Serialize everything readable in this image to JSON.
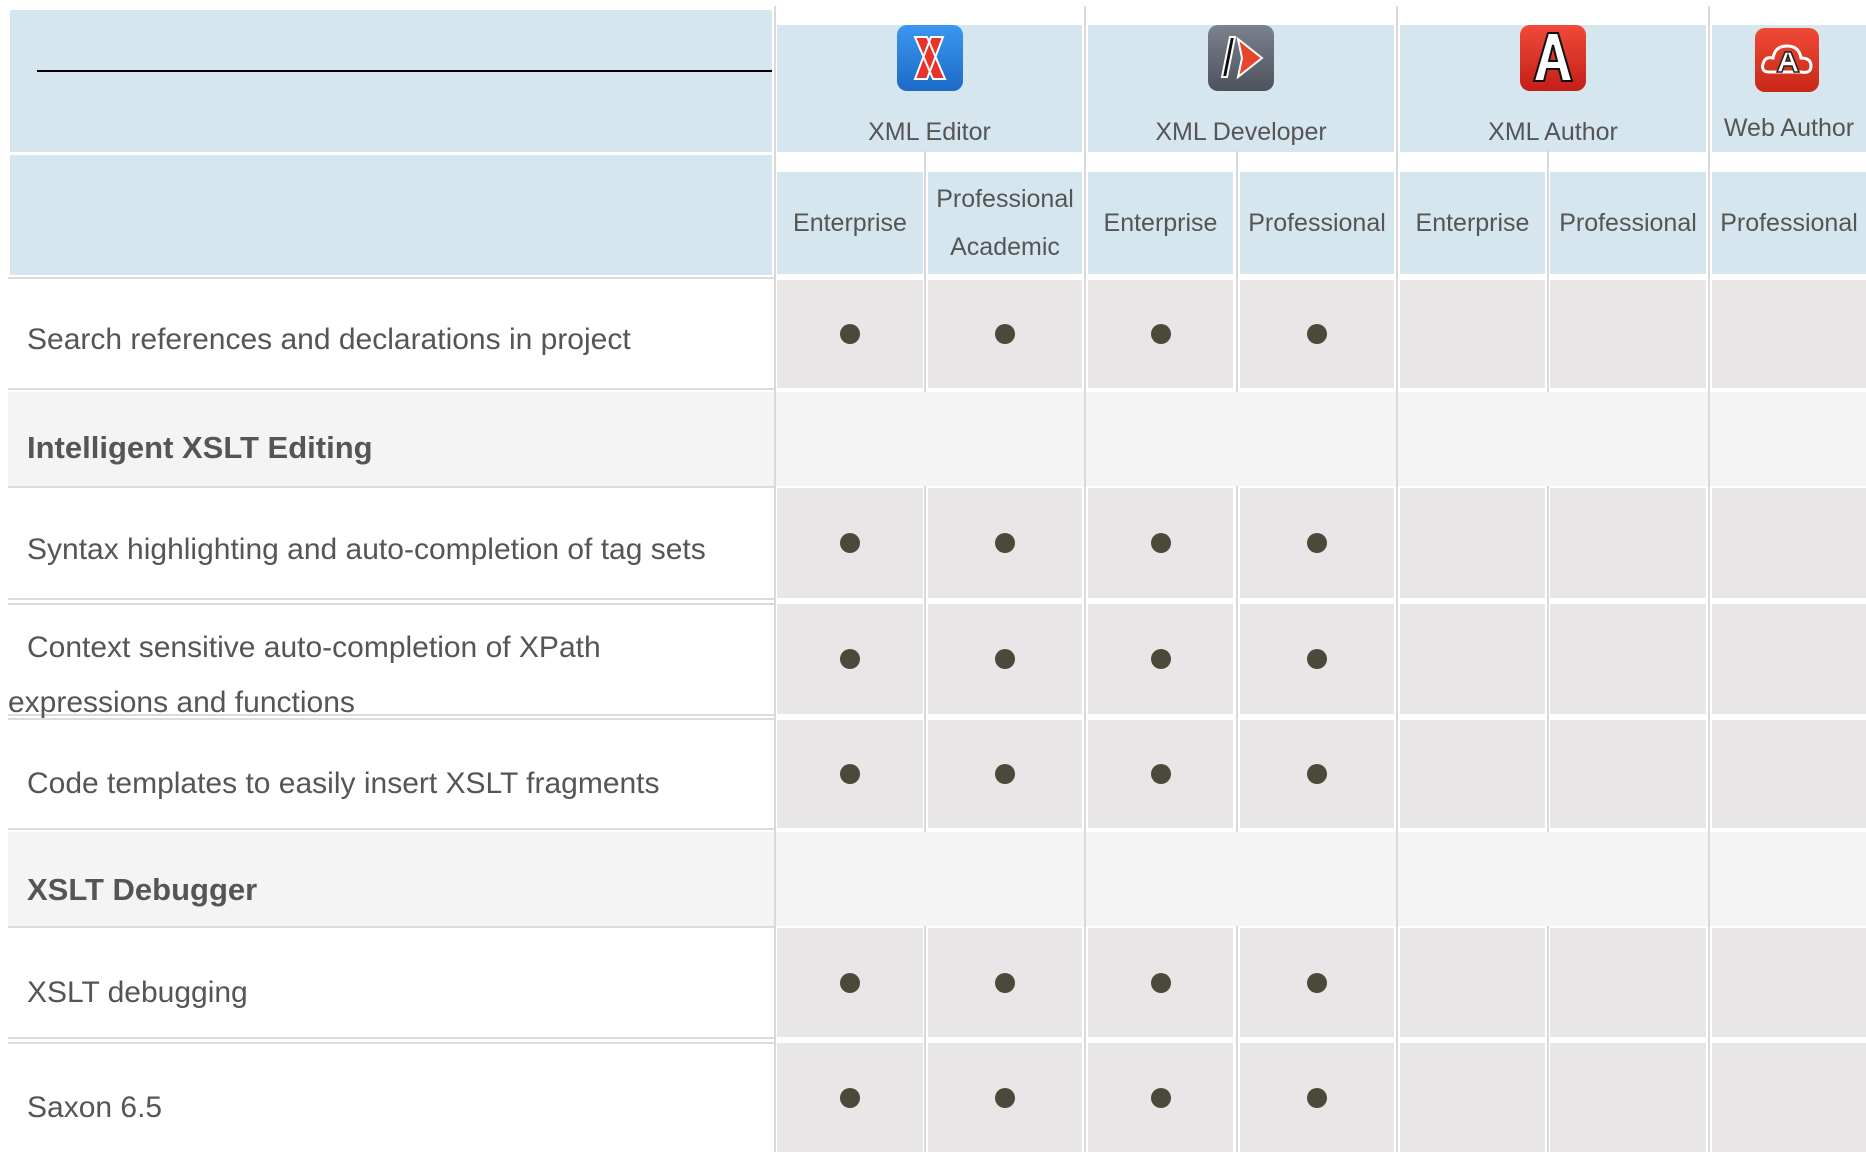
{
  "products": [
    {
      "name": "XML Editor",
      "logo_icon": "xml-editor-logo-icon",
      "logo_glyph": "X",
      "color": "#2f86e0"
    },
    {
      "name": "XML Developer",
      "logo_icon": "xml-developer-logo-icon",
      "logo_glyph": "|>",
      "color": "#5e6673"
    },
    {
      "name": "XML Author",
      "logo_icon": "xml-author-logo-icon",
      "logo_glyph": "A",
      "color": "#e1312a"
    },
    {
      "name": "Web Author",
      "logo_icon": "web-author-logo-icon",
      "logo_glyph": "A",
      "color": "#dd3324"
    }
  ],
  "editions": [
    {
      "line1": "Enterprise",
      "line2": ""
    },
    {
      "line1": "Professional",
      "line2": "Academic"
    },
    {
      "line1": "Enterprise",
      "line2": ""
    },
    {
      "line1": "Professional",
      "line2": ""
    },
    {
      "line1": "Enterprise",
      "line2": ""
    },
    {
      "line1": "Professional",
      "line2": ""
    },
    {
      "line1": "Professional",
      "line2": ""
    }
  ],
  "rows": [
    {
      "type": "feature",
      "label": "Search references and declarations in project",
      "support": [
        true,
        true,
        true,
        true,
        false,
        false,
        false
      ]
    },
    {
      "type": "section",
      "label": "Intelligent XSLT Editing"
    },
    {
      "type": "feature",
      "label": "Syntax highlighting and auto-completion of tag sets",
      "support": [
        true,
        true,
        true,
        true,
        false,
        false,
        false
      ]
    },
    {
      "type": "feature",
      "label_line1": "Context sensitive auto-completion of XPath",
      "label_line2": "expressions and functions",
      "support": [
        true,
        true,
        true,
        true,
        false,
        false,
        false
      ]
    },
    {
      "type": "feature",
      "label": "Code templates to easily insert XSLT fragments",
      "support": [
        true,
        true,
        true,
        true,
        false,
        false,
        false
      ]
    },
    {
      "type": "section",
      "label": "XSLT Debugger"
    },
    {
      "type": "feature",
      "label": "XSLT debugging",
      "support": [
        true,
        true,
        true,
        true,
        false,
        false,
        false
      ]
    },
    {
      "type": "feature",
      "label": "Saxon 6.5",
      "support": [
        true,
        true,
        true,
        true,
        false,
        false,
        false
      ]
    }
  ],
  "colors": {
    "header_bg": "#d6e6ef",
    "cell_bg": "#e8e6e6",
    "section_bg": "#f4f4f4",
    "dot": "#4a4a3a"
  }
}
